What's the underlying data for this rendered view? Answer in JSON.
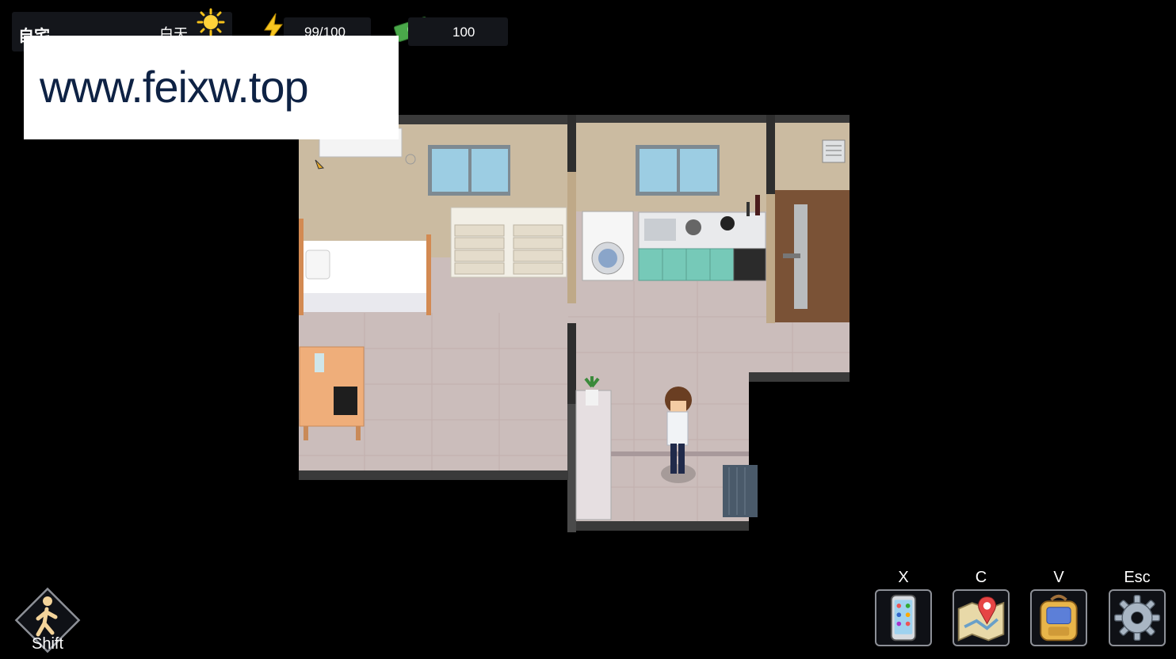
{
  "hud": {
    "location": "自宅",
    "time_of_day": "白天",
    "energy": "99/100",
    "money": "100",
    "sun_icon": "sun-icon",
    "energy_icon": "lightning-bolt-icon",
    "money_icon": "cash-icon"
  },
  "watermark": {
    "text": "www.feixw.top"
  },
  "hotkeys": [
    {
      "key": "X",
      "icon": "phone-icon"
    },
    {
      "key": "C",
      "icon": "map-icon"
    },
    {
      "key": "V",
      "icon": "backpack-icon"
    },
    {
      "key": "Esc",
      "icon": "gear-icon"
    }
  ],
  "shift": {
    "label": "Shift",
    "icon": "walking-person-icon"
  },
  "colors": {
    "wall": "#cbbba1",
    "floor": "#ccbdba",
    "counter_teal": "#76c9b8",
    "door": "#7a5236"
  }
}
